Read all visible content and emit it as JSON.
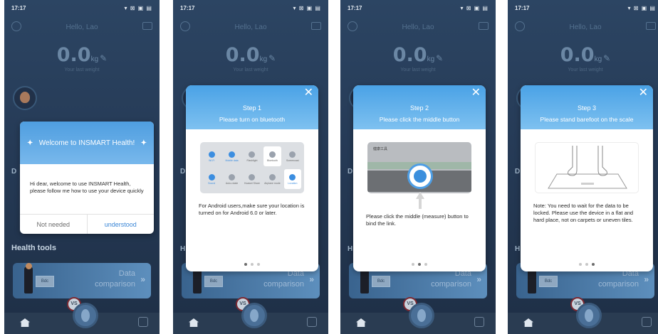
{
  "status_time": "17:17",
  "status_icons": "▾ ⊠ ▣ ▤",
  "app": {
    "title": "Hello, Lao",
    "weight": "0.0",
    "unit": "kg",
    "subtitle": "Your last weight",
    "letter_d": "D",
    "letter_h": "H",
    "health_tools": "Health tools",
    "card_title_1": "Data",
    "card_title_2": "comparison",
    "card_sign": "Bdc",
    "vs": "VS"
  },
  "welcome": {
    "title": "Welcome to INSMART Health!",
    "message": "Hi dear, welcome to use INSMART Health, please follow me how to use your device quickly",
    "not_needed": "Not needed",
    "understood": "understood"
  },
  "step1": {
    "title": "Step 1",
    "subtitle": "Please turn on bluetooth",
    "note": "For Android users,make sure your location is turned on for Android 6.0 or later.",
    "tiles": [
      "Wi-Fi",
      "Mobile data",
      "Flashlight",
      "Bluetooth",
      "Screencast",
      "Sound",
      "Auto-rotate",
      "Huawei Share",
      "Airplane mode",
      "Location"
    ]
  },
  "step2": {
    "title": "Step 2",
    "subtitle": "Please click the middle button",
    "note": "Please click the middle (measure) button to bind the link.",
    "app_header": "健康工具"
  },
  "step3": {
    "title": "Step 3",
    "subtitle": "Please stand barefoot on the scale",
    "note": "Note: You need to wait for the data to be locked. Please use the device in a flat and hard place, not on carpets or uneven tiles."
  },
  "colors": {
    "accent": "#4aa2e6",
    "link": "#3a86d6",
    "overlay": "#1d2d40"
  },
  "icons": [
    "close-icon",
    "home-icon",
    "measure-icon",
    "bluetooth-icon",
    "edit-icon"
  ]
}
